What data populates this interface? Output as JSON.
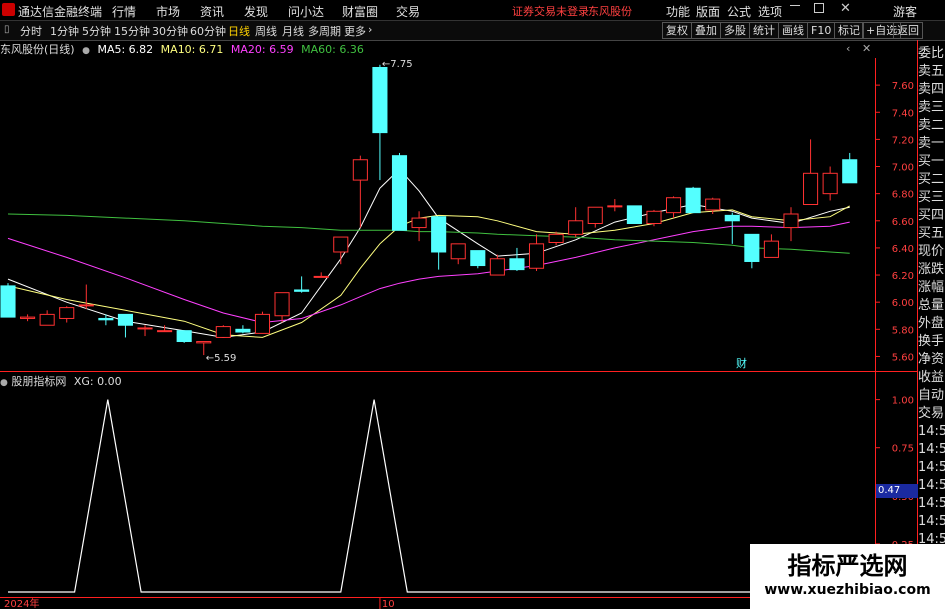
{
  "topbar": {
    "app_title": "通达信金融终端",
    "menu": [
      "行情",
      "市场",
      "资讯",
      "发现",
      "问小达",
      "财富圈",
      "交易"
    ],
    "warning": "证券交易未登录",
    "stock": "东风股份",
    "right_menu": [
      "功能",
      "版面",
      "公式",
      "选项"
    ],
    "user": "游客"
  },
  "toolbar": {
    "periods": [
      "分时",
      "1分钟",
      "5分钟",
      "15分钟",
      "30分钟",
      "60分钟",
      "日线",
      "周线",
      "月线",
      "多周期",
      "更多"
    ],
    "active": "日线",
    "right_buttons": [
      "复权",
      "叠加",
      "多股",
      "统计",
      "画线",
      "F10",
      "标记",
      "+自选",
      "返回"
    ]
  },
  "main_legend": {
    "title": "东风股份(日线)",
    "ma5": "MA5: 6.82",
    "ma10": "MA10: 6.71",
    "ma20": "MA20: 6.59",
    "ma60": "MA60: 6.36"
  },
  "sub_legend": {
    "title": "股朋指标网",
    "xg": "XG: 0.00"
  },
  "sidebar_top": [
    "委比",
    "卖五",
    "卖四",
    "卖三",
    "卖二",
    "卖一",
    "买一",
    "买二",
    "买三",
    "买四",
    "买五",
    "现价",
    "涨跌",
    "涨幅",
    "总量",
    "外盘",
    "换手",
    "净资",
    "收益"
  ],
  "sidebar_bottom": [
    "自动",
    "交易",
    "14:56",
    "14:56",
    "14:56",
    "14:56",
    "14:56",
    "14:56",
    "14:56",
    "14:56",
    "14:56",
    "14:56"
  ],
  "marker_cai": "财",
  "current_value_box": "0.47",
  "watermark": {
    "title": "指标严选网",
    "url": "www.xuezhibiao.com"
  },
  "colors": {
    "up": "#ff3232",
    "down": "#54ffff",
    "ma5": "#ffffff",
    "ma10": "#ffff80",
    "ma20": "#ff40ff",
    "ma60": "#40c040",
    "indicator": "#ffffff"
  },
  "chart_data": [
    {
      "type": "candlestick",
      "title": "东风股份(日线)",
      "ylim": [
        5.5,
        7.8
      ],
      "yticks": [
        5.6,
        5.8,
        6.0,
        6.2,
        6.4,
        6.6,
        6.8,
        7.0,
        7.2,
        7.4,
        7.6
      ],
      "xlabels": [
        {
          "label": "2024年",
          "index": 0
        },
        {
          "label": "10",
          "index": 19
        }
      ],
      "annotations": [
        {
          "text": "7.75",
          "index": 19
        },
        {
          "text": "5.59",
          "index": 10
        }
      ],
      "candles": [
        {
          "o": 6.12,
          "h": 6.14,
          "c": 5.89,
          "l": 5.89
        },
        {
          "o": 5.88,
          "h": 5.91,
          "c": 5.89,
          "l": 5.86
        },
        {
          "o": 5.83,
          "h": 5.94,
          "c": 5.91,
          "l": 5.83
        },
        {
          "o": 5.88,
          "h": 5.97,
          "c": 5.96,
          "l": 5.85
        },
        {
          "o": 5.98,
          "h": 6.13,
          "c": 5.98,
          "l": 5.95
        },
        {
          "o": 5.88,
          "h": 5.91,
          "c": 5.87,
          "l": 5.83
        },
        {
          "o": 5.91,
          "h": 5.91,
          "c": 5.83,
          "l": 5.74
        },
        {
          "o": 5.81,
          "h": 5.83,
          "c": 5.81,
          "l": 5.75
        },
        {
          "o": 5.79,
          "h": 5.83,
          "c": 5.79,
          "l": 5.78
        },
        {
          "o": 5.79,
          "h": 5.79,
          "c": 5.71,
          "l": 5.7
        },
        {
          "o": 5.7,
          "h": 5.71,
          "c": 5.71,
          "l": 5.61
        },
        {
          "o": 5.74,
          "h": 5.83,
          "c": 5.82,
          "l": 5.74
        },
        {
          "o": 5.8,
          "h": 5.83,
          "c": 5.78,
          "l": 5.77
        },
        {
          "o": 5.77,
          "h": 5.93,
          "c": 5.91,
          "l": 5.77
        },
        {
          "o": 5.9,
          "h": 6.07,
          "c": 6.07,
          "l": 5.85
        },
        {
          "o": 6.09,
          "h": 6.19,
          "c": 6.08,
          "l": 6.07
        },
        {
          "o": 6.19,
          "h": 6.22,
          "c": 6.19,
          "l": 6.19
        },
        {
          "o": 6.37,
          "h": 6.48,
          "c": 6.48,
          "l": 6.28
        },
        {
          "o": 6.9,
          "h": 7.08,
          "c": 7.05,
          "l": 6.55
        },
        {
          "o": 7.73,
          "h": 7.75,
          "c": 7.25,
          "l": 6.9
        },
        {
          "o": 7.08,
          "h": 7.1,
          "c": 6.53,
          "l": 6.53
        },
        {
          "o": 6.55,
          "h": 6.67,
          "c": 6.62,
          "l": 6.45
        },
        {
          "o": 6.63,
          "h": 6.63,
          "c": 6.37,
          "l": 6.24
        },
        {
          "o": 6.32,
          "h": 6.43,
          "c": 6.43,
          "l": 6.28
        },
        {
          "o": 6.38,
          "h": 6.38,
          "c": 6.27,
          "l": 6.25
        },
        {
          "o": 6.2,
          "h": 6.35,
          "c": 6.32,
          "l": 6.2
        },
        {
          "o": 6.32,
          "h": 6.4,
          "c": 6.24,
          "l": 6.23
        },
        {
          "o": 6.25,
          "h": 6.5,
          "c": 6.43,
          "l": 6.23
        },
        {
          "o": 6.44,
          "h": 6.52,
          "c": 6.5,
          "l": 6.42
        },
        {
          "o": 6.5,
          "h": 6.7,
          "c": 6.6,
          "l": 6.48
        },
        {
          "o": 6.58,
          "h": 6.7,
          "c": 6.7,
          "l": 6.55
        },
        {
          "o": 6.71,
          "h": 6.76,
          "c": 6.71,
          "l": 6.67
        },
        {
          "o": 6.71,
          "h": 6.71,
          "c": 6.58,
          "l": 6.58
        },
        {
          "o": 6.58,
          "h": 6.68,
          "c": 6.67,
          "l": 6.56
        },
        {
          "o": 6.66,
          "h": 6.78,
          "c": 6.77,
          "l": 6.62
        },
        {
          "o": 6.84,
          "h": 6.85,
          "c": 6.66,
          "l": 6.66
        },
        {
          "o": 6.68,
          "h": 6.77,
          "c": 6.76,
          "l": 6.65
        },
        {
          "o": 6.64,
          "h": 6.66,
          "c": 6.6,
          "l": 6.43
        },
        {
          "o": 6.5,
          "h": 6.5,
          "c": 6.3,
          "l": 6.25
        },
        {
          "o": 6.33,
          "h": 6.5,
          "c": 6.45,
          "l": 6.33
        },
        {
          "o": 6.55,
          "h": 6.7,
          "c": 6.65,
          "l": 6.45
        },
        {
          "o": 6.72,
          "h": 7.2,
          "c": 6.95,
          "l": 6.72
        },
        {
          "o": 6.8,
          "h": 7.0,
          "c": 6.95,
          "l": 6.75
        },
        {
          "o": 7.05,
          "h": 7.1,
          "c": 6.88,
          "l": 6.88
        }
      ],
      "ma": [
        {
          "name": "MA5",
          "color": "#ffffff",
          "points": [
            [
              0,
              6.17
            ],
            [
              3,
              6.0
            ],
            [
              6,
              5.86
            ],
            [
              9,
              5.79
            ],
            [
              11,
              5.74
            ],
            [
              13,
              5.78
            ],
            [
              15,
              5.92
            ],
            [
              17,
              6.32
            ],
            [
              18,
              6.55
            ],
            [
              19,
              6.84
            ],
            [
              20,
              6.98
            ],
            [
              21,
              6.82
            ],
            [
              22,
              6.62
            ],
            [
              24,
              6.43
            ],
            [
              25,
              6.34
            ],
            [
              27,
              6.36
            ],
            [
              29,
              6.46
            ],
            [
              31,
              6.59
            ],
            [
              33,
              6.66
            ],
            [
              35,
              6.72
            ],
            [
              37,
              6.67
            ],
            [
              38,
              6.62
            ],
            [
              40,
              6.58
            ],
            [
              42,
              6.67
            ],
            [
              43,
              6.7
            ]
          ]
        },
        {
          "name": "MA10",
          "color": "#ffff80",
          "points": [
            [
              0,
              6.12
            ],
            [
              3,
              6.02
            ],
            [
              6,
              5.94
            ],
            [
              9,
              5.86
            ],
            [
              11,
              5.76
            ],
            [
              13,
              5.74
            ],
            [
              15,
              5.85
            ],
            [
              17,
              6.05
            ],
            [
              18,
              6.25
            ],
            [
              19,
              6.43
            ],
            [
              20,
              6.56
            ],
            [
              21,
              6.62
            ],
            [
              22,
              6.64
            ],
            [
              24,
              6.63
            ],
            [
              25,
              6.6
            ],
            [
              27,
              6.52
            ],
            [
              29,
              6.5
            ],
            [
              31,
              6.53
            ],
            [
              33,
              6.58
            ],
            [
              35,
              6.66
            ],
            [
              37,
              6.68
            ],
            [
              38,
              6.63
            ],
            [
              40,
              6.6
            ],
            [
              42,
              6.63
            ],
            [
              43,
              6.71
            ]
          ]
        },
        {
          "name": "MA20",
          "color": "#ff40ff",
          "points": [
            [
              0,
              6.47
            ],
            [
              3,
              6.33
            ],
            [
              6,
              6.18
            ],
            [
              9,
              6.02
            ],
            [
              11,
              5.92
            ],
            [
              13,
              5.85
            ],
            [
              15,
              5.88
            ],
            [
              17,
              5.98
            ],
            [
              18,
              6.04
            ],
            [
              19,
              6.1
            ],
            [
              20,
              6.14
            ],
            [
              21,
              6.17
            ],
            [
              22,
              6.19
            ],
            [
              24,
              6.21
            ],
            [
              25,
              6.23
            ],
            [
              27,
              6.27
            ],
            [
              29,
              6.33
            ],
            [
              31,
              6.4
            ],
            [
              33,
              6.46
            ],
            [
              35,
              6.52
            ],
            [
              37,
              6.56
            ],
            [
              38,
              6.56
            ],
            [
              40,
              6.55
            ],
            [
              42,
              6.56
            ],
            [
              43,
              6.59
            ]
          ]
        },
        {
          "name": "MA60",
          "color": "#40c040",
          "points": [
            [
              0,
              6.65
            ],
            [
              3,
              6.64
            ],
            [
              6,
              6.62
            ],
            [
              9,
              6.6
            ],
            [
              11,
              6.58
            ],
            [
              13,
              6.56
            ],
            [
              15,
              6.55
            ],
            [
              17,
              6.53
            ],
            [
              18,
              6.53
            ],
            [
              19,
              6.53
            ],
            [
              20,
              6.53
            ],
            [
              21,
              6.52
            ],
            [
              22,
              6.52
            ],
            [
              24,
              6.51
            ],
            [
              25,
              6.5
            ],
            [
              27,
              6.49
            ],
            [
              29,
              6.48
            ],
            [
              31,
              6.46
            ],
            [
              33,
              6.45
            ],
            [
              35,
              6.44
            ],
            [
              37,
              6.42
            ],
            [
              38,
              6.4
            ],
            [
              40,
              6.39
            ],
            [
              42,
              6.37
            ],
            [
              43,
              6.36
            ]
          ]
        }
      ]
    },
    {
      "type": "line",
      "title": "股朋指标网",
      "series": [
        {
          "name": "XG",
          "values": [
            0,
            0,
            0,
            1,
            0,
            0,
            0,
            0,
            0,
            0,
            0,
            1,
            0,
            0,
            0,
            0,
            0,
            0,
            0,
            0,
            0,
            0,
            0,
            0,
            0,
            0,
            0,
            0,
            0,
            0,
            0,
            0,
            0,
            0,
            0,
            0,
            0,
            0,
            0,
            0,
            0,
            0,
            0,
            0
          ]
        }
      ],
      "ylim": [
        0,
        1.05
      ],
      "yticks": [
        1.0,
        0.75,
        0.5,
        0.25
      ]
    }
  ]
}
